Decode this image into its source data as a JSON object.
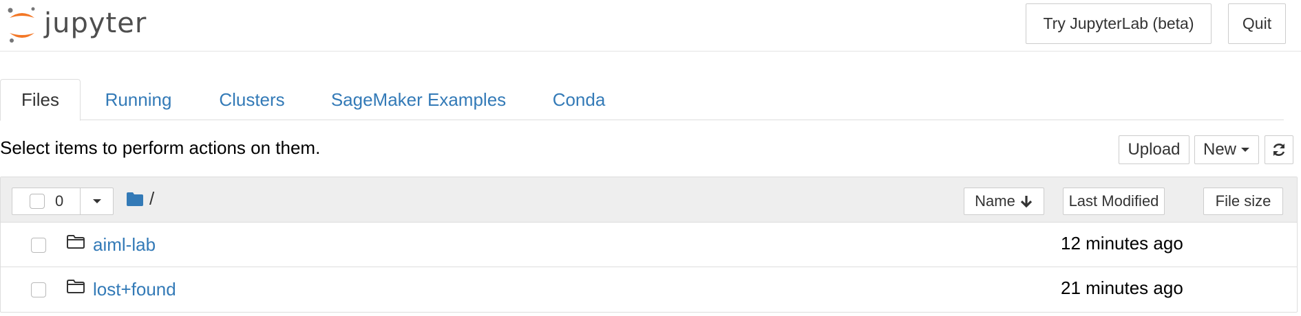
{
  "header": {
    "logo_text": "jupyter",
    "buttons": {
      "try_lab": "Try JupyterLab (beta)",
      "quit": "Quit"
    }
  },
  "tabs": [
    {
      "label": "Files",
      "active": true
    },
    {
      "label": "Running"
    },
    {
      "label": "Clusters"
    },
    {
      "label": "SageMaker Examples"
    },
    {
      "label": "Conda"
    }
  ],
  "toolbar": {
    "info": "Select items to perform actions on them.",
    "upload": "Upload",
    "new": "New",
    "refresh_icon": "refresh-icon"
  },
  "list_header": {
    "selected_count": "0",
    "path": "/",
    "sort_name": "Name",
    "sort_last_modified": "Last Modified",
    "sort_file_size": "File size"
  },
  "items": [
    {
      "name": "aiml-lab",
      "modified": "12 minutes ago",
      "icon": "folder-icon"
    },
    {
      "name": "lost+found",
      "modified": "21 minutes ago",
      "icon": "folder-icon"
    }
  ],
  "colors": {
    "link": "#337ab7",
    "logo_orange": "#f37726",
    "folder_blue": "#337ab7"
  }
}
